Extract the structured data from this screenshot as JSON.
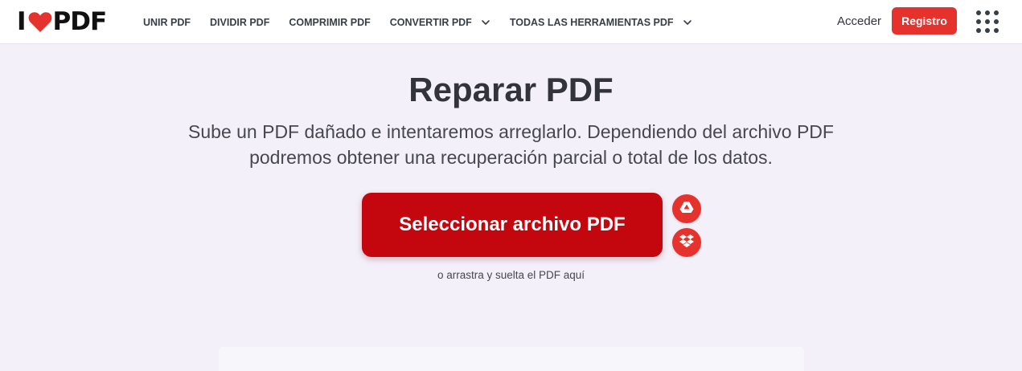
{
  "brand": {
    "logo_left": "I",
    "logo_right": "PDF"
  },
  "nav": {
    "items": [
      {
        "label": "UNIR PDF",
        "has_dropdown": false
      },
      {
        "label": "DIVIDIR PDF",
        "has_dropdown": false
      },
      {
        "label": "COMPRIMIR PDF",
        "has_dropdown": false
      },
      {
        "label": "CONVERTIR PDF",
        "has_dropdown": true
      },
      {
        "label": "TODAS LAS HERRAMIENTAS PDF",
        "has_dropdown": true
      }
    ],
    "login_label": "Acceder",
    "signup_label": "Registro",
    "apps_icon": "apps-grid-icon"
  },
  "main": {
    "title": "Reparar PDF",
    "subtitle_line1": "Sube un PDF dañado e intentaremos arreglarlo. Dependiendo del archivo PDF",
    "subtitle_line2": "podremos obtener una recuperación parcial o total de los datos.",
    "select_button_label": "Seleccionar archivo PDF",
    "drop_hint": "o arrastra y suelta el PDF aquí",
    "cloud_buttons": [
      {
        "icon": "google-drive-icon"
      },
      {
        "icon": "dropbox-icon"
      }
    ]
  },
  "colors": {
    "brand_red": "#e5322d",
    "button_red": "#c4060f",
    "background": "#f3f0fa",
    "text_dark": "#33333b"
  }
}
